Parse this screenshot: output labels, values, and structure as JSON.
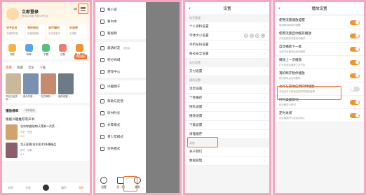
{
  "screen1": {
    "login": "立即登录",
    "login_sub": "登录后领取专属VIP礼包",
    "cards": [
      {
        "title": "VIP会员",
        "sub": "开通享特权"
      },
      {
        "title": "我的钱包",
        "sub": "充值领福利"
      },
      {
        "title": "金币福利",
        "sub": "天天领金币"
      },
      {
        "title": "听读券",
        "sub": "去领取"
      }
    ],
    "grid": [
      {
        "label": "书架",
        "color": "#f7b53b"
      },
      {
        "label": "听单",
        "color": "#5aa2f6"
      },
      {
        "label": "下载",
        "color": "#52c27e"
      },
      {
        "label": "已购",
        "color": "#f07a7a"
      },
      {
        "label": "新人福利",
        "color": "#f2932b"
      }
    ],
    "badge": "领取福利",
    "tabs": [
      "历史",
      "收藏",
      "音乐",
      "下载"
    ],
    "books": [
      {
        "name": "节目已经关闭…",
        "color": "#c9b89c"
      },
      {
        "name": "我为华夏…",
        "color": "#7b8fb0"
      },
      {
        "name": "万古神帝…",
        "color": "#c68b6e"
      },
      {
        "name": "我的老婆…",
        "color": "#6d7a88"
      },
      {
        "name": "我的师父…",
        "color": "#a56b7c"
      }
    ],
    "rank_title": "播放榜单",
    "rank_tag": "本周更新",
    "recommend": "根据兴趣推荐有声书",
    "rows": [
      {
        "title": "北宋穿越指南(天策府+洪荒…",
        "desc": "历史 · 完结",
        "score": "9.0",
        "color": "#d2a36b"
      },
      {
        "title": "龙王医婿(苏东医术)多播精品",
        "desc": "都市 · 连载",
        "score": "9.2",
        "color": "#8c5f6c"
      }
    ],
    "bottom": [
      "首页",
      "分类",
      "",
      "福利",
      "我的"
    ]
  },
  "screen2": {
    "items": [
      {
        "label": "看小说",
        "extra": ""
      },
      {
        "label": "看书本",
        "extra": ""
      },
      {
        "label": "看视频",
        "extra": ""
      },
      {
        "label": "邀请好友",
        "extra": "领现金"
      },
      {
        "label": "积分商城",
        "extra": ""
      },
      {
        "label": "游戏中心",
        "extra": ""
      },
      {
        "label": "兴趣圈子",
        "extra": ""
      },
      {
        "label": "帮助与反馈",
        "extra": ""
      },
      {
        "label": "听书时长",
        "extra": ""
      },
      {
        "label": "长辈模式",
        "extra": ""
      },
      {
        "label": "青少年模式",
        "extra": ""
      },
      {
        "label": "深色模式",
        "extra": ""
      }
    ],
    "bottom": [
      "设置",
      "扫一扫",
      "福利"
    ]
  },
  "screen3": {
    "title": "设置",
    "sec1": "账号管理",
    "group1": [
      "个人资料设置",
      "字体大小设置",
      "手机号码设置",
      "账号安全设置"
    ],
    "font_sizes": [
      "小",
      "中",
      "大",
      "特"
    ],
    "sec2": "支付设置",
    "group2": [
      "支付设置"
    ],
    "sec3": "通用设置",
    "group3": [
      "消息设置",
      "个性推荐",
      "隐私设置",
      "播放设置",
      "下载设置",
      "清理缓存"
    ],
    "sec4": "其他",
    "group4": [
      "关于我们",
      "数据管理"
    ]
  },
  "screen4": {
    "title": "播放设置",
    "items": [
      {
        "label": "使用流量播放提醒",
        "desc": "使用移动网络时提醒",
        "on": true
      },
      {
        "label": "使用流量自动缓存播放",
        "desc": "开启后使用流量自动缓存",
        "on": true
      },
      {
        "label": "自动播放下一集",
        "desc": "当前节目播完后自动播放",
        "on": true
      },
      {
        "label": "播放上一次播放",
        "desc": "打开应用后播放上次节目",
        "on": true
      },
      {
        "label": "耳机断开暂停播放",
        "desc": "拔出耳机后自动暂停",
        "on": true
      },
      {
        "label": "允许与其他应用同时播放",
        "desc": "开启后可与其他应用同时播放音频",
        "on": false
      },
      {
        "label": "时时桌面歌词",
        "desc": "在桌面显示歌词",
        "on": true
      },
      {
        "label": "定时关闭",
        "desc": "设定播放时长后自动停止",
        "on": true
      }
    ]
  }
}
